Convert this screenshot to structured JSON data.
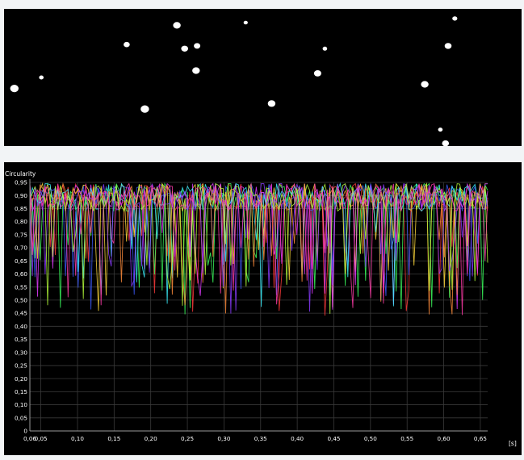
{
  "particles": [
    [
      0.02,
      0.58,
      1.1
    ],
    [
      0.072,
      0.5,
      0.6
    ],
    [
      0.237,
      0.26,
      0.8
    ],
    [
      0.272,
      0.73,
      1.1
    ],
    [
      0.334,
      0.12,
      1.0
    ],
    [
      0.349,
      0.29,
      0.9
    ],
    [
      0.373,
      0.27,
      0.85
    ],
    [
      0.371,
      0.45,
      1.0
    ],
    [
      0.467,
      0.1,
      0.55
    ],
    [
      0.517,
      0.69,
      1.0
    ],
    [
      0.606,
      0.47,
      0.95
    ],
    [
      0.62,
      0.29,
      0.6
    ],
    [
      0.813,
      0.55,
      1.0
    ],
    [
      0.843,
      0.88,
      0.6
    ],
    [
      0.853,
      0.98,
      0.9
    ],
    [
      0.858,
      0.27,
      0.9
    ],
    [
      0.871,
      0.07,
      0.65
    ]
  ],
  "chart_data": {
    "type": "line",
    "title": "",
    "xlabel": "",
    "ylabel": "Circularity",
    "x_unit": "[s]",
    "xlim": [
      0.06,
      0.685
    ],
    "ylim": [
      0,
      0.95
    ],
    "grid": true,
    "x_ticks": [
      "0,06",
      "0,05",
      "0,10",
      "0,15",
      "0,20",
      "0,25",
      "0,30",
      "0,35",
      "0,40",
      "0,45",
      "0,50",
      "0,55",
      "0,60",
      "0,65"
    ],
    "x_tick_values": [
      0.06,
      0.075,
      0.125,
      0.175,
      0.225,
      0.275,
      0.325,
      0.375,
      0.425,
      0.475,
      0.525,
      0.575,
      0.625,
      0.675
    ],
    "y_ticks": [
      "0",
      "0,05",
      "0,10",
      "0,15",
      "0,20",
      "0,25",
      "0,30",
      "0,35",
      "0,40",
      "0,45",
      "0,50",
      "0,55",
      "0,60",
      "0,65",
      "0,70",
      "0,75",
      "0,80",
      "0,85",
      "0,90",
      "0,95"
    ],
    "y_tick_values": [
      0,
      0.05,
      0.1,
      0.15,
      0.2,
      0.25,
      0.3,
      0.35,
      0.4,
      0.45,
      0.5,
      0.55,
      0.6,
      0.65,
      0.7,
      0.75,
      0.8,
      0.85,
      0.9,
      0.95
    ],
    "series_colors": [
      "#ff3b3b",
      "#3b5bff",
      "#3bff5e",
      "#ffd93b",
      "#e23bff",
      "#3bf2ff",
      "#ff8c3b",
      "#8a3bff",
      "#b6ff3b",
      "#ff3ba8"
    ],
    "series_count": 10,
    "typical_range": [
      0.78,
      0.95
    ],
    "dip_min": 0.44
  }
}
